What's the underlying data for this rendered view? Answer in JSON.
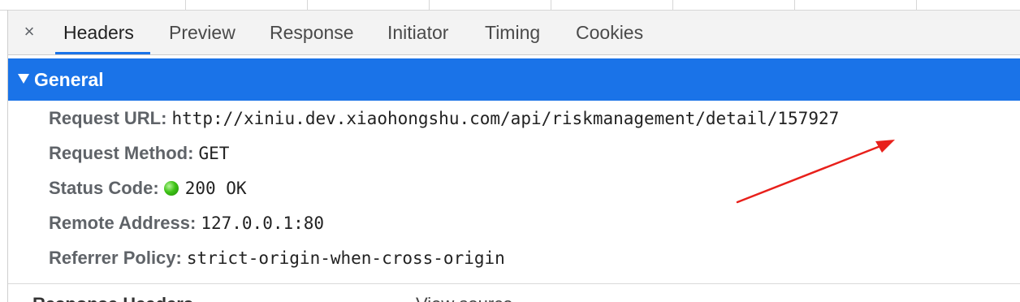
{
  "tabs": {
    "close_label": "×",
    "items": [
      {
        "label": "Headers",
        "active": true
      },
      {
        "label": "Preview",
        "active": false
      },
      {
        "label": "Response",
        "active": false
      },
      {
        "label": "Initiator",
        "active": false
      },
      {
        "label": "Timing",
        "active": false
      },
      {
        "label": "Cookies",
        "active": false
      }
    ]
  },
  "general": {
    "title": "General",
    "rows": [
      {
        "label": "Request URL:",
        "value": "http://xiniu.dev.xiaohongshu.com/api/riskmanagement/detail/157927"
      },
      {
        "label": "Request Method:",
        "value": "GET"
      },
      {
        "label": "Status Code:",
        "value": "200 OK",
        "status_color": "#2fb80f"
      },
      {
        "label": "Remote Address:",
        "value": "127.0.0.1:80"
      },
      {
        "label": "Referrer Policy:",
        "value": "strict-origin-when-cross-origin"
      }
    ]
  },
  "next_section": {
    "title": "Response Headers",
    "view_link": "View source"
  },
  "colors": {
    "accent": "#1a73e8",
    "annotation": "#e8201b"
  }
}
